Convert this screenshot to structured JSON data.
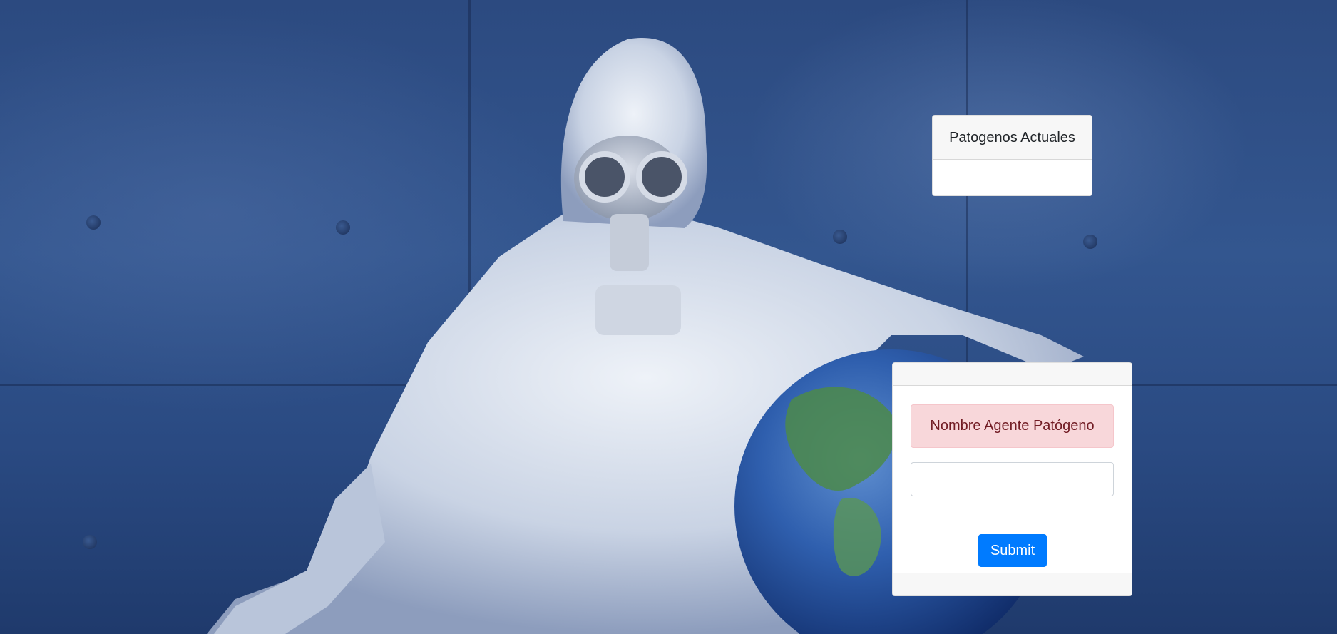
{
  "pathogen_list": {
    "title": "Patogenos Actuales"
  },
  "pathogen_form": {
    "label": "Nombre Agente Patógeno",
    "input_value": "",
    "input_placeholder": "",
    "submit_label": "Submit"
  },
  "colors": {
    "primary": "#007bff",
    "alert_bg": "#f8d7da",
    "alert_text": "#721c24",
    "background": "#2c4a80"
  },
  "background_image": {
    "subject": "hazmat-suit-figure-holding-earth"
  }
}
